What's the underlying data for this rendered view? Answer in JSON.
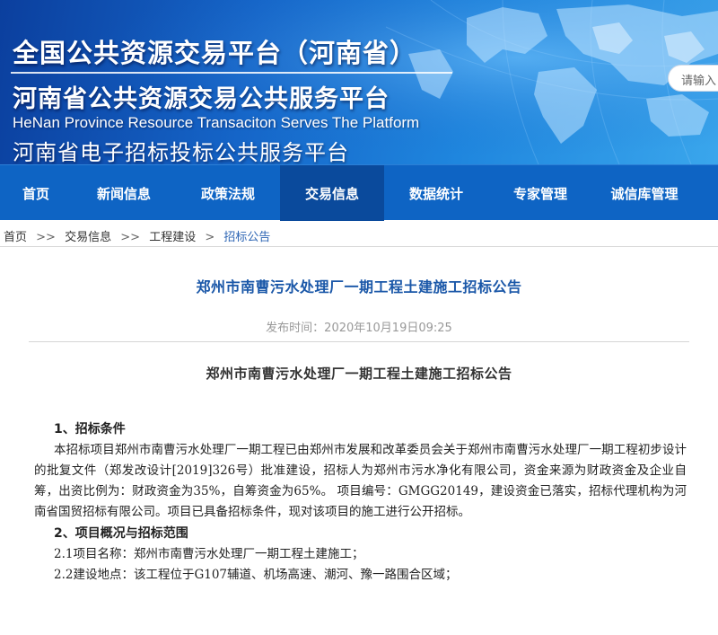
{
  "header": {
    "title_main": "全国公共资源交易平台（河南省）",
    "title_sub": "河南省公共资源交易公共服务平台",
    "title_en": "HeNan Province Resource Transaciton Serves The Platform",
    "title_ebid": "河南省电子招标投标公共服务平台",
    "search_placeholder": "请输入"
  },
  "nav": {
    "items": [
      "首页",
      "新闻信息",
      "政策法规",
      "交易信息",
      "数据统计",
      "专家管理",
      "诚信库管理"
    ],
    "active": "交易信息"
  },
  "breadcrumb": {
    "items": [
      "首页",
      "交易信息",
      "工程建设",
      "招标公告"
    ],
    "separators": [
      ">>",
      ">>",
      ">"
    ]
  },
  "article": {
    "title": "郑州市南曹污水处理厂一期工程土建施工招标公告",
    "publish_time": "发布时间：2020年10月19日09:25",
    "inner_title": "郑州市南曹污水处理厂一期工程土建施工招标公告",
    "section1_heading": "1、招标条件",
    "section1_body": "本招标项目郑州市南曹污水处理厂一期工程已由郑州市发展和改革委员会关于郑州市南曹污水处理厂一期工程初步设计的批复文件（郑发改设计[2019]326号）批准建设，招标人为郑州市污水净化有限公司，资金来源为财政资金及企业自筹，出资比例为：财政资金为35%，自筹资金为65%。 项目编号：GMGG20149，建设资金已落实，招标代理机构为河南省国贸招标有限公司。项目已具备招标条件，现对该项目的施工进行公开招标。",
    "section2_heading": "2、项目概况与招标范围",
    "item_2_1": "2.1项目名称：郑州市南曹污水处理厂一期工程土建施工；",
    "item_2_2": "2.2建设地点：该工程位于G107辅道、机场高速、潮河、豫一路围合区域；"
  },
  "colors": {
    "nav_bg": "#0e64c4",
    "nav_active": "#0a4a9c",
    "title_blue": "#1a57a8",
    "breadcrumb_current": "#2d65b4"
  }
}
